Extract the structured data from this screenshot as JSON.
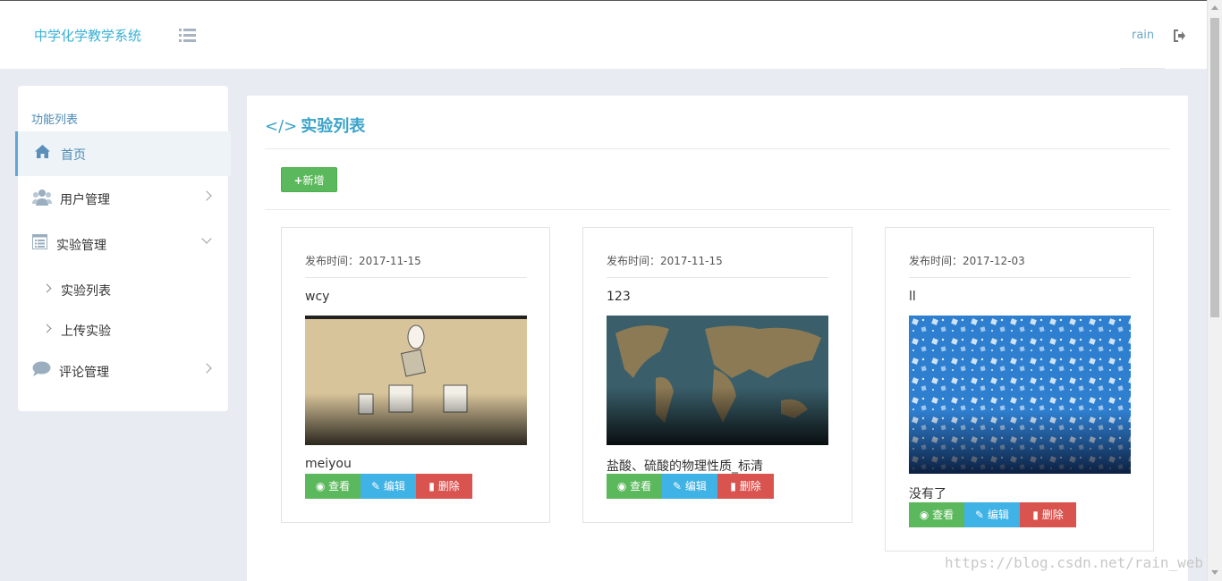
{
  "header": {
    "brand": "中学化学教学系统",
    "username": "rain"
  },
  "sidebar": {
    "title": "功能列表",
    "items": [
      {
        "label": "首页",
        "icon": "home-icon",
        "active": true
      },
      {
        "label": "用户管理",
        "icon": "users-icon",
        "expanded": false
      },
      {
        "label": "实验管理",
        "icon": "list-icon",
        "expanded": true,
        "children": [
          {
            "label": "实验列表"
          },
          {
            "label": "上传实验"
          }
        ]
      },
      {
        "label": "评论管理",
        "icon": "comment-icon",
        "expanded": false
      }
    ]
  },
  "main": {
    "title": "实验列表",
    "add_label": "新增",
    "cards": [
      {
        "date_label": "发布时间：",
        "date": "2017-11-15",
        "title": "wcy",
        "description": "meiyou",
        "actions": {
          "view": "查看",
          "edit": "编辑",
          "delete": "删除"
        }
      },
      {
        "date_label": "发布时间：",
        "date": "2017-11-15",
        "title": "123",
        "description": "盐酸、硫酸的物理性质_标清",
        "actions": {
          "view": "查看",
          "edit": "编辑",
          "delete": "删除"
        }
      },
      {
        "date_label": "发布时间：",
        "date": "2017-12-03",
        "title": "ll",
        "description": "没有了",
        "actions": {
          "view": "查看",
          "edit": "编辑",
          "delete": "删除"
        }
      }
    ]
  },
  "watermark": "https://blog.csdn.net/rain_web",
  "colors": {
    "brand": "#3ab0d6",
    "success": "#5cb85c",
    "info": "#3fb2e6",
    "danger": "#d9534f",
    "active_border": "#5fa7d8"
  }
}
